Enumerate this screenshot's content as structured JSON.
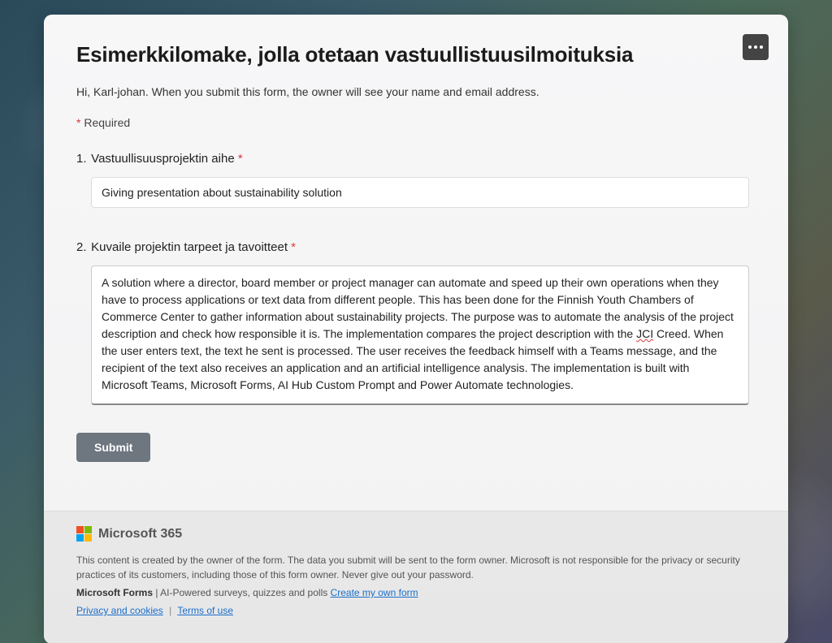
{
  "form": {
    "title": "Esimerkkilomake, jolla otetaan vastuullistuusilmoituksia",
    "greeting": "Hi, Karl-johan. When you submit this form, the owner will see your name and email address.",
    "required_label": "Required",
    "asterisk": "*",
    "questions": [
      {
        "number": "1.",
        "label": "Vastuullisuusprojektin aihe",
        "required": true,
        "value": "Giving presentation about sustainability solution"
      },
      {
        "number": "2.",
        "label": "Kuvaile projektin tarpeet ja tavoitteet",
        "required": true,
        "value_pre": "A solution where a director, board member or project manager can automate and speed up their own operations when they have to process applications or text data from different people. This has been done for the Finnish Youth Chambers of Commerce Center to gather information about sustainability projects. The purpose was to automate the analysis of the project description and check how responsible it is. The implementation compares the project description with the ",
        "value_err": "JCI",
        "value_post": " Creed. When the user enters text, the text he sent is processed. The user receives the feedback himself with a Teams message, and the recipient of the text also receives an application and an artificial intelligence analysis. The implementation is built with Microsoft Teams, Microsoft Forms, AI Hub Custom Prompt and Power Automate technologies.",
        "value_full": "A solution where a director, board member or project manager can automate and speed up their own operations when they have to process applications or text data from different people. This has been done for the Finnish Youth Chambers of Commerce Center to gather information about sustainability projects. The purpose was to automate the analysis of the project description and check how responsible it is. The implementation compares the project description with the JCI Creed. When the user enters text, the text he sent is processed. The user receives the feedback himself with a Teams message, and the recipient of the text also receives an application and an artificial intelligence analysis. The implementation is built with Microsoft Teams, Microsoft Forms, AI Hub Custom Prompt and Power Automate technologies."
      }
    ],
    "submit_label": "Submit"
  },
  "footer": {
    "brand": "Microsoft 365",
    "disclaimer": "This content is created by the owner of the form. The data you submit will be sent to the form owner. Microsoft is not responsible for the privacy or security practices of its customers, including those of this form owner. Never give out your password.",
    "forms_label": "Microsoft Forms",
    "forms_tagline": " | AI-Powered surveys, quizzes and polls ",
    "create_link": "Create my own form",
    "privacy_link": "Privacy and cookies",
    "terms_link": "Terms of use",
    "sep": "|"
  }
}
